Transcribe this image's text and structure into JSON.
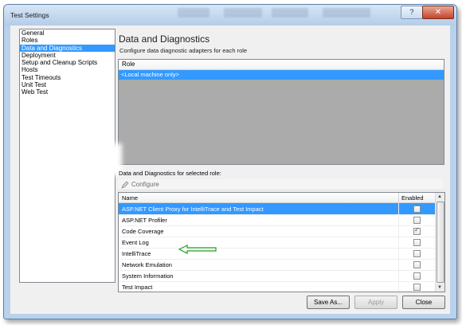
{
  "window": {
    "title": "Test Settings",
    "help_label": "?",
    "close_label": "✕"
  },
  "nav": {
    "items": [
      {
        "label": "General",
        "selected": false
      },
      {
        "label": "Roles",
        "selected": false
      },
      {
        "label": "Data and Diagnostics",
        "selected": true
      },
      {
        "label": "Deployment",
        "selected": false
      },
      {
        "label": "Setup and Cleanup Scripts",
        "selected": false
      },
      {
        "label": "Hosts",
        "selected": false
      },
      {
        "label": "Test Timeouts",
        "selected": false
      },
      {
        "label": "Unit Test",
        "selected": false
      },
      {
        "label": "Web Test",
        "selected": false
      }
    ]
  },
  "panel": {
    "title": "Data and Diagnostics",
    "subtitle": "Configure data diagnostic adapters for each role",
    "roles_header": "Role",
    "roles_row": "<Local machine only>",
    "adapters_label": "Data and Diagnostics for selected role:",
    "configure_label": "Configure",
    "grid": {
      "col_name": "Name",
      "col_enabled": "Enabled",
      "rows": [
        {
          "name": "ASP.NET Client Proxy for IntelliTrace and Test Impact",
          "enabled": false,
          "selected": true
        },
        {
          "name": "ASP.NET Profiler",
          "enabled": false,
          "selected": false
        },
        {
          "name": "Code Coverage",
          "enabled": true,
          "selected": false
        },
        {
          "name": "Event Log",
          "enabled": false,
          "selected": false
        },
        {
          "name": "IntelliTrace",
          "enabled": false,
          "selected": false
        },
        {
          "name": "Network Emulation",
          "enabled": false,
          "selected": false
        },
        {
          "name": "System Information",
          "enabled": false,
          "selected": false
        },
        {
          "name": "Test Impact",
          "enabled": false,
          "selected": false
        }
      ]
    },
    "annotation_color": "#22a022"
  },
  "buttons": {
    "save_as": "Save As...",
    "apply": "Apply",
    "close": "Close"
  },
  "icons": {
    "configure": "pencil-icon",
    "scroll_up": "scroll-up-icon",
    "scroll_down": "scroll-down-icon"
  }
}
